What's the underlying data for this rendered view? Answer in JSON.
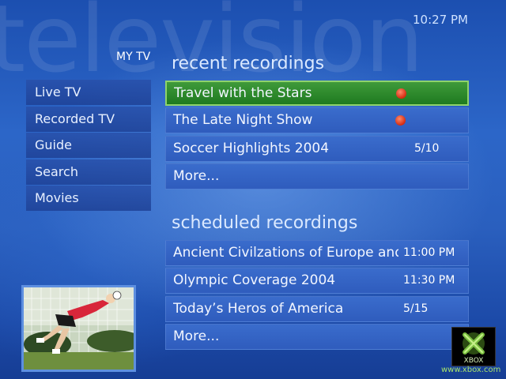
{
  "watermark": "television",
  "clock": "10:27 PM",
  "page_title": "MY TV",
  "nav": {
    "items": [
      {
        "label": "Live TV"
      },
      {
        "label": "Recorded TV"
      },
      {
        "label": "Guide"
      },
      {
        "label": "Search"
      },
      {
        "label": "Movies"
      }
    ]
  },
  "recent": {
    "title": "recent recordings",
    "rows": [
      {
        "title": "Travel with the Stars",
        "meta": "",
        "recording": true,
        "selected": true
      },
      {
        "title": "The Late Night Show",
        "meta": "",
        "recording": true,
        "selected": false
      },
      {
        "title": "Soccer Highlights 2004",
        "meta": "5/10",
        "recording": false,
        "selected": false
      },
      {
        "title": "More...",
        "meta": "",
        "recording": false,
        "selected": false
      }
    ]
  },
  "scheduled": {
    "title": "scheduled recordings",
    "rows": [
      {
        "title": "Ancient Civilzations of Europe and Asia",
        "meta": "11:00 PM"
      },
      {
        "title": "Olympic Coverage 2004",
        "meta": "11:30 PM"
      },
      {
        "title": "Today’s Heros of America",
        "meta": "5/15"
      },
      {
        "title": "More...",
        "meta": ""
      }
    ]
  },
  "logo": {
    "brand": "XBOX",
    "url": "www.xbox.com",
    "brand_color": "#7dc142"
  },
  "colors": {
    "selected_row": "#2a8a28",
    "row": "#3464c6",
    "record_dot": "#e0341a"
  }
}
